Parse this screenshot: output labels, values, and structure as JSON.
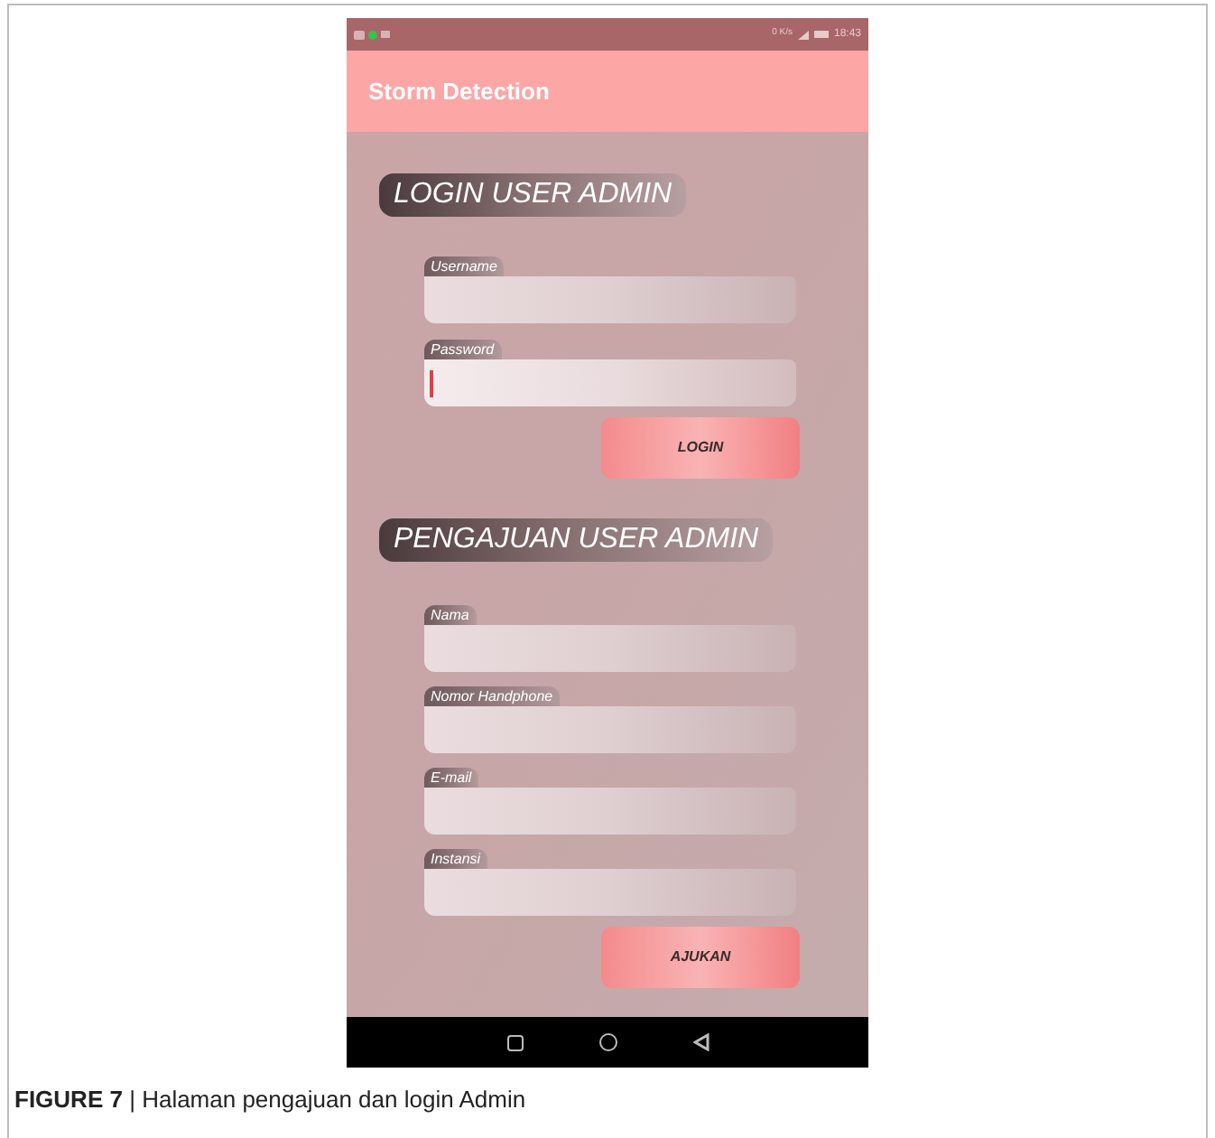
{
  "status_bar": {
    "network_speed": "0 K/s",
    "time": "18:43"
  },
  "app_bar": {
    "title": "Storm Detection"
  },
  "login": {
    "heading": "LOGIN USER ADMIN",
    "fields": [
      {
        "label": "Username",
        "focused": false
      },
      {
        "label": "Password",
        "focused": true
      }
    ],
    "button": "LOGIN"
  },
  "registration": {
    "heading": "PENGAJUAN USER ADMIN",
    "fields": [
      {
        "label": "Nama",
        "focused": false
      },
      {
        "label": "Nomor Handphone",
        "focused": false
      },
      {
        "label": "E-mail",
        "focused": false
      },
      {
        "label": "Instansi",
        "focused": false
      }
    ],
    "button": "AJUKAN"
  },
  "caption": {
    "text": "**FIGURE 7** | Halaman pengajuan dan login Admin"
  }
}
